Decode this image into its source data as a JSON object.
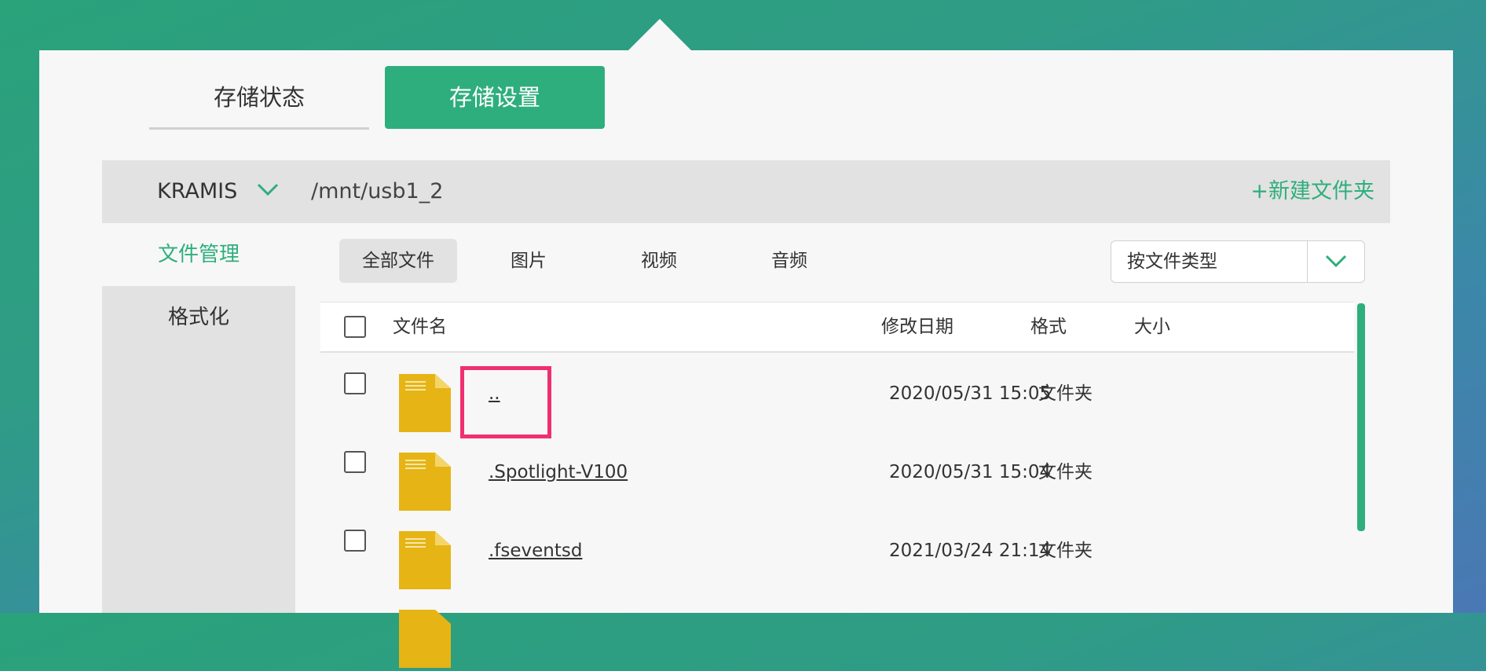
{
  "tabs": {
    "status_label": "存储状态",
    "settings_label": "存储设置"
  },
  "pathbar": {
    "device": "KRAMIS",
    "path": "/mnt/usb1_2",
    "new_folder_label": "+新建文件夹"
  },
  "sidebar": {
    "file_manage": "文件管理",
    "format": "格式化"
  },
  "filters": {
    "all": "全部文件",
    "images": "图片",
    "videos": "视频",
    "audio": "音频"
  },
  "sort": {
    "label": "按文件类型"
  },
  "table": {
    "headers": {
      "name": "文件名",
      "date": "修改日期",
      "format": "格式",
      "size": "大小"
    },
    "rows": [
      {
        "name": "..",
        "date": "2020/05/31 15:05",
        "type": "文件夹"
      },
      {
        "name": ".Spotlight-V100",
        "date": "2020/05/31 15:04",
        "type": "文件夹"
      },
      {
        "name": ".fseventsd",
        "date": "2021/03/24 21:14",
        "type": "文件夹"
      }
    ]
  },
  "colors": {
    "accent": "#2fae7d",
    "highlight": "#f0306e",
    "folder": "#e6b414"
  }
}
